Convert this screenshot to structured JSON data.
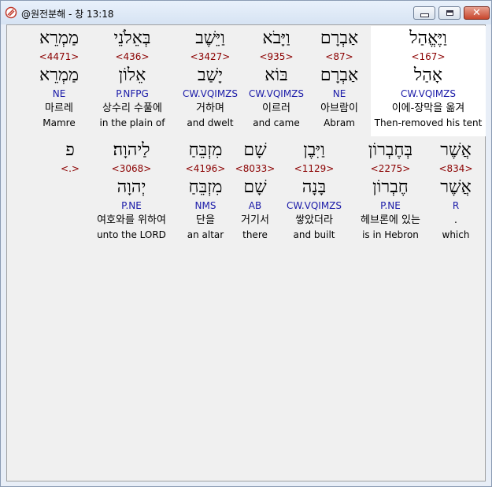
{
  "window": {
    "title": "@원전분해 - 창 13:18",
    "close_label": "✕"
  },
  "rows": [
    {
      "words": [
        {
          "text": "וַיֶּאֱהַל",
          "strong": "<167>",
          "lemma": "אָהַל",
          "parse": "CW.VQIMZS",
          "korean": "이에-장막을 옮겨",
          "english": "Then-removed his tent",
          "highlighted": true
        },
        {
          "text": "אַבְרָם",
          "strong": "<87>",
          "lemma": "אַבְרָם",
          "parse": "NE",
          "korean": "아브람이",
          "english": "Abram"
        },
        {
          "text": "וַיָּבֹא",
          "strong": "<935>",
          "lemma": "בּוֹא",
          "parse": "CW.VQIMZS",
          "korean": "이르러",
          "english": "and came"
        },
        {
          "text": "וַיֵּשֶׁב",
          "strong": "<3427>",
          "lemma": "יָשַׁב",
          "parse": "CW.VQIMZS",
          "korean": "거하며",
          "english": "and dwelt"
        },
        {
          "text": "בְּאֵלֹנֵי",
          "strong": "<436>",
          "lemma": "אֵלוֹן",
          "parse": "P.NFPG",
          "korean": "상수리 수풀에",
          "english": "in the plain of"
        },
        {
          "text": "מַמְרֵא",
          "strong": "<4471>",
          "lemma": "מַמְרֵא",
          "parse": "NE",
          "korean": "마르레",
          "english": "Mamre"
        }
      ]
    },
    {
      "words": [
        {
          "text": "אֲשֶׁר",
          "strong": "<834>",
          "lemma": "אֲשֶׁר",
          "parse": "R",
          "korean": ".",
          "english": "which"
        },
        {
          "text": "בְּחֶבְרוֹן",
          "strong": "<2275>",
          "lemma": "חֶבְרוֹן",
          "parse": "P.NE",
          "korean": "헤브론에 있는",
          "english": "is in Hebron"
        },
        {
          "text": "וַיִּבֶן",
          "strong": "<1129>",
          "lemma": "בָּנָה",
          "parse": "CW.VQIMZS",
          "korean": "쌓았더라",
          "english": "and built"
        },
        {
          "text": "שָׁם",
          "strong": "<8033>",
          "lemma": "שָׁם",
          "parse": "AB",
          "korean": "거기서",
          "english": "there"
        },
        {
          "text": "מִזְבֵּחַ",
          "strong": "<4196>",
          "lemma": "מִזְבֵּחַ",
          "parse": "NMS",
          "korean": "단을",
          "english": "an altar"
        },
        {
          "text": "לַיהוָה׃",
          "strong": "<3068>",
          "lemma": "יְהוָה",
          "parse": "P.NE",
          "korean": "여호와를 위하여",
          "english": "unto the LORD"
        },
        {
          "text": "פ",
          "strong": "<.>",
          "lemma": "",
          "parse": "",
          "korean": "",
          "english": ""
        }
      ]
    }
  ]
}
